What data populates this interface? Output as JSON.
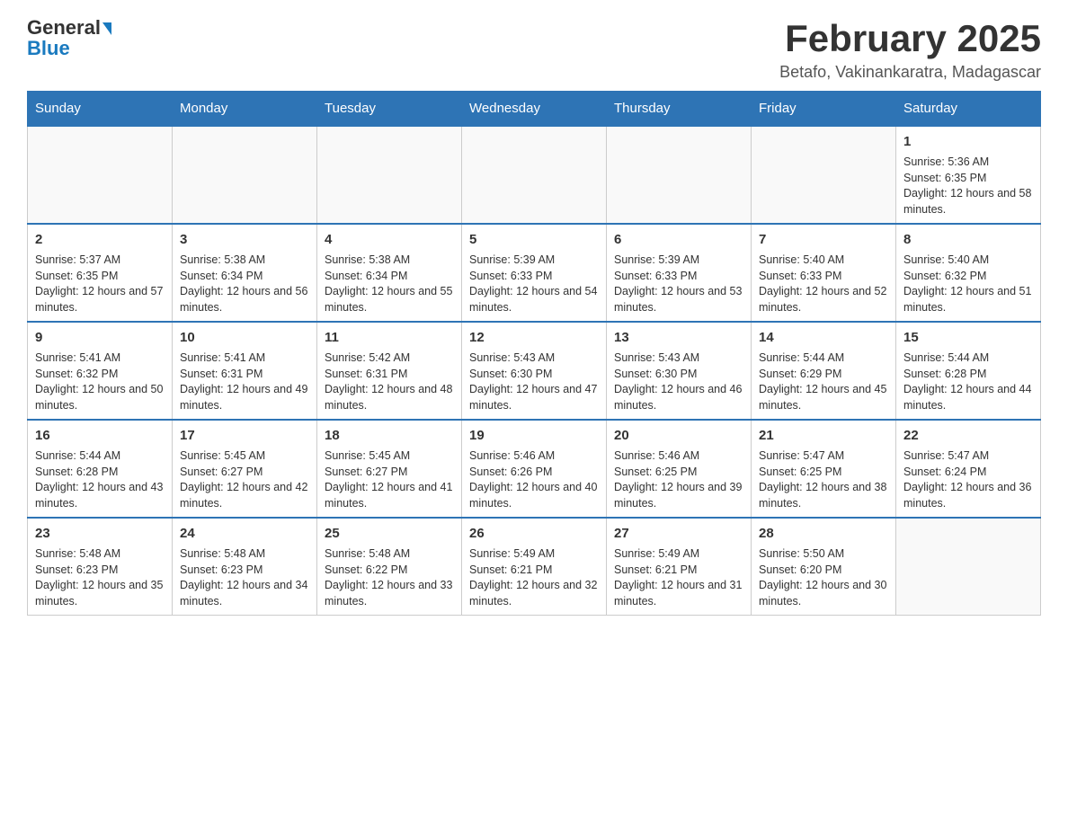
{
  "logo": {
    "general": "General",
    "blue": "Blue",
    "arrow": "▲"
  },
  "title": "February 2025",
  "subtitle": "Betafo, Vakinankaratra, Madagascar",
  "days_of_week": [
    "Sunday",
    "Monday",
    "Tuesday",
    "Wednesday",
    "Thursday",
    "Friday",
    "Saturday"
  ],
  "weeks": [
    {
      "days": [
        {
          "num": "",
          "info": ""
        },
        {
          "num": "",
          "info": ""
        },
        {
          "num": "",
          "info": ""
        },
        {
          "num": "",
          "info": ""
        },
        {
          "num": "",
          "info": ""
        },
        {
          "num": "",
          "info": ""
        },
        {
          "num": "1",
          "info": "Sunrise: 5:36 AM\nSunset: 6:35 PM\nDaylight: 12 hours and 58 minutes."
        }
      ]
    },
    {
      "days": [
        {
          "num": "2",
          "info": "Sunrise: 5:37 AM\nSunset: 6:35 PM\nDaylight: 12 hours and 57 minutes."
        },
        {
          "num": "3",
          "info": "Sunrise: 5:38 AM\nSunset: 6:34 PM\nDaylight: 12 hours and 56 minutes."
        },
        {
          "num": "4",
          "info": "Sunrise: 5:38 AM\nSunset: 6:34 PM\nDaylight: 12 hours and 55 minutes."
        },
        {
          "num": "5",
          "info": "Sunrise: 5:39 AM\nSunset: 6:33 PM\nDaylight: 12 hours and 54 minutes."
        },
        {
          "num": "6",
          "info": "Sunrise: 5:39 AM\nSunset: 6:33 PM\nDaylight: 12 hours and 53 minutes."
        },
        {
          "num": "7",
          "info": "Sunrise: 5:40 AM\nSunset: 6:33 PM\nDaylight: 12 hours and 52 minutes."
        },
        {
          "num": "8",
          "info": "Sunrise: 5:40 AM\nSunset: 6:32 PM\nDaylight: 12 hours and 51 minutes."
        }
      ]
    },
    {
      "days": [
        {
          "num": "9",
          "info": "Sunrise: 5:41 AM\nSunset: 6:32 PM\nDaylight: 12 hours and 50 minutes."
        },
        {
          "num": "10",
          "info": "Sunrise: 5:41 AM\nSunset: 6:31 PM\nDaylight: 12 hours and 49 minutes."
        },
        {
          "num": "11",
          "info": "Sunrise: 5:42 AM\nSunset: 6:31 PM\nDaylight: 12 hours and 48 minutes."
        },
        {
          "num": "12",
          "info": "Sunrise: 5:43 AM\nSunset: 6:30 PM\nDaylight: 12 hours and 47 minutes."
        },
        {
          "num": "13",
          "info": "Sunrise: 5:43 AM\nSunset: 6:30 PM\nDaylight: 12 hours and 46 minutes."
        },
        {
          "num": "14",
          "info": "Sunrise: 5:44 AM\nSunset: 6:29 PM\nDaylight: 12 hours and 45 minutes."
        },
        {
          "num": "15",
          "info": "Sunrise: 5:44 AM\nSunset: 6:28 PM\nDaylight: 12 hours and 44 minutes."
        }
      ]
    },
    {
      "days": [
        {
          "num": "16",
          "info": "Sunrise: 5:44 AM\nSunset: 6:28 PM\nDaylight: 12 hours and 43 minutes."
        },
        {
          "num": "17",
          "info": "Sunrise: 5:45 AM\nSunset: 6:27 PM\nDaylight: 12 hours and 42 minutes."
        },
        {
          "num": "18",
          "info": "Sunrise: 5:45 AM\nSunset: 6:27 PM\nDaylight: 12 hours and 41 minutes."
        },
        {
          "num": "19",
          "info": "Sunrise: 5:46 AM\nSunset: 6:26 PM\nDaylight: 12 hours and 40 minutes."
        },
        {
          "num": "20",
          "info": "Sunrise: 5:46 AM\nSunset: 6:25 PM\nDaylight: 12 hours and 39 minutes."
        },
        {
          "num": "21",
          "info": "Sunrise: 5:47 AM\nSunset: 6:25 PM\nDaylight: 12 hours and 38 minutes."
        },
        {
          "num": "22",
          "info": "Sunrise: 5:47 AM\nSunset: 6:24 PM\nDaylight: 12 hours and 36 minutes."
        }
      ]
    },
    {
      "days": [
        {
          "num": "23",
          "info": "Sunrise: 5:48 AM\nSunset: 6:23 PM\nDaylight: 12 hours and 35 minutes."
        },
        {
          "num": "24",
          "info": "Sunrise: 5:48 AM\nSunset: 6:23 PM\nDaylight: 12 hours and 34 minutes."
        },
        {
          "num": "25",
          "info": "Sunrise: 5:48 AM\nSunset: 6:22 PM\nDaylight: 12 hours and 33 minutes."
        },
        {
          "num": "26",
          "info": "Sunrise: 5:49 AM\nSunset: 6:21 PM\nDaylight: 12 hours and 32 minutes."
        },
        {
          "num": "27",
          "info": "Sunrise: 5:49 AM\nSunset: 6:21 PM\nDaylight: 12 hours and 31 minutes."
        },
        {
          "num": "28",
          "info": "Sunrise: 5:50 AM\nSunset: 6:20 PM\nDaylight: 12 hours and 30 minutes."
        },
        {
          "num": "",
          "info": ""
        }
      ]
    }
  ]
}
